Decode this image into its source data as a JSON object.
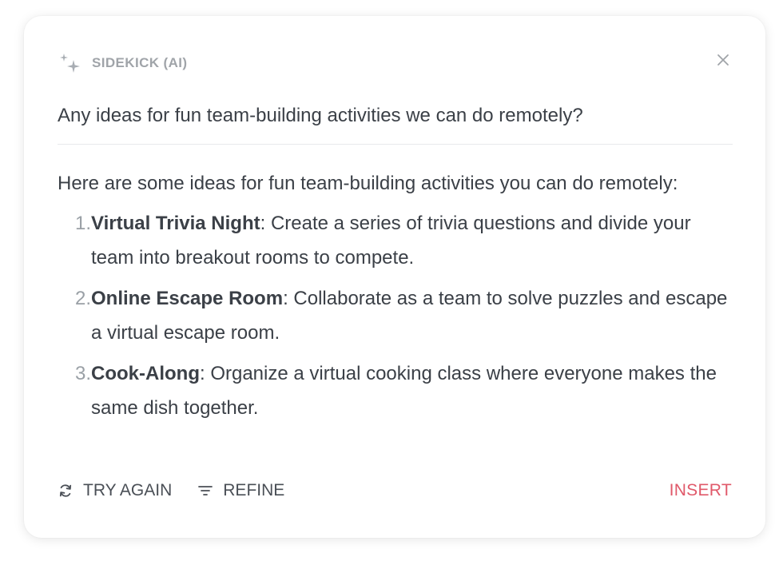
{
  "header": {
    "title": "SIDEKICK (AI)",
    "icon": "sparkle-icon",
    "close_icon": "close-icon"
  },
  "prompt": "Any ideas for fun team-building activities we can do remotely?",
  "answer": {
    "intro": "Here are some ideas for fun team-building activities you can do remotely:",
    "items": [
      {
        "number": "1.",
        "title": "Virtual Trivia Night",
        "text": ": Create a series of trivia questions and divide your team into breakout rooms to compete."
      },
      {
        "number": "2.",
        "title": "Online Escape Room",
        "text": ": Collaborate as a team to solve puzzles and escape a virtual escape room."
      },
      {
        "number": "3.",
        "title": "Cook-Along",
        "text": ": Organize a virtual cooking class where everyone makes the same dish together."
      }
    ]
  },
  "footer": {
    "try_again_label": "TRY AGAIN",
    "refine_label": "REFINE",
    "insert_label": "INSERT"
  },
  "colors": {
    "accent": "#e0596a",
    "text": "#3b4047",
    "muted": "#a0a4a9"
  }
}
